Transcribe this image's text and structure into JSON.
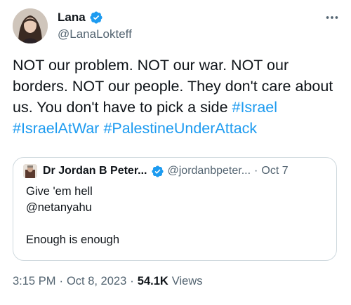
{
  "author": {
    "display_name": "Lana",
    "handle": "@LanaLokteff",
    "avatar_icon": "profile-photo",
    "verified_icon": "verified-badge-icon"
  },
  "more_icon": "more-horizontal-icon",
  "tweet": {
    "text_before": "NOT our problem. NOT our war. NOT our borders. NOT our people. They don't care about us. You don't have to pick a side ",
    "hashtags": [
      "#Israel",
      "#IsraelAtWar",
      "#PalestineUnderAttack"
    ]
  },
  "quote": {
    "display_name": "Dr Jordan B Peter...",
    "handle": "@jordanbpeter...",
    "separator": "·",
    "date": "Oct 7",
    "lines": [
      "Give 'em hell",
      "@netanyahu",
      "",
      "Enough is enough"
    ]
  },
  "meta": {
    "time": "3:15 PM",
    "separator": "·",
    "date": "Oct 8, 2023",
    "views_count": "54.1K",
    "views_label": "Views"
  },
  "colors": {
    "accent": "#1d9bf0",
    "text_primary": "#0f1419",
    "text_secondary": "#536471",
    "border": "#cfd9de"
  }
}
